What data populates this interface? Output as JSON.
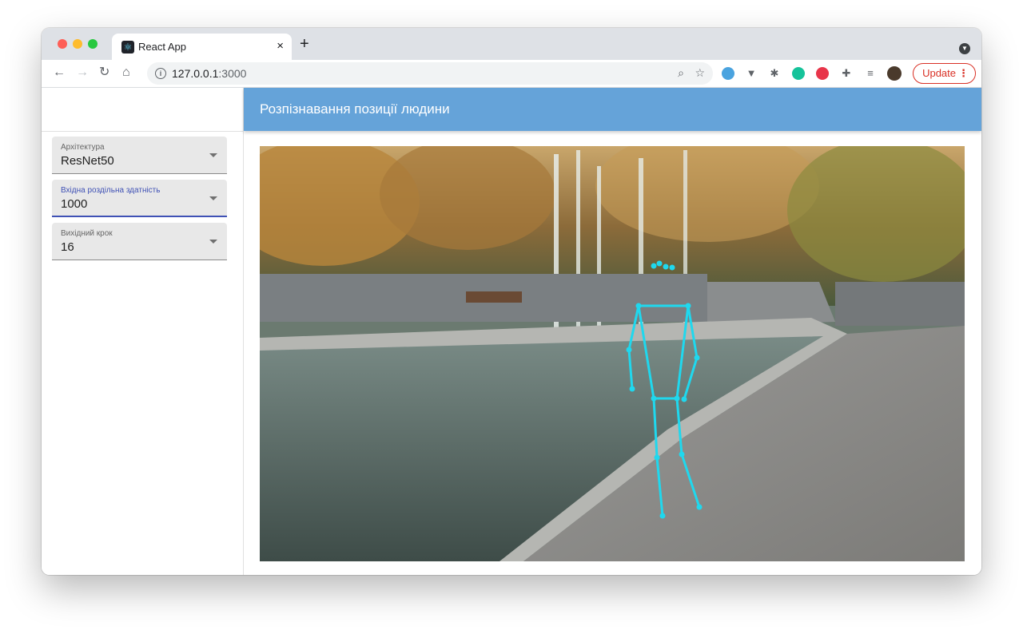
{
  "browser": {
    "tab_title": "React App",
    "tab_close": "×",
    "new_tab": "+",
    "url_host": "127.0.0.1",
    "url_port": ":3000",
    "update_label": "Update",
    "update_menu": "⋮"
  },
  "app": {
    "title": "Розпізнавання позиції людини"
  },
  "controls": [
    {
      "label": "Архітектура",
      "value": "ResNet50"
    },
    {
      "label": "Вхідна роздільна здатність",
      "value": "1000"
    },
    {
      "label": "Вихідний крок",
      "value": "16"
    }
  ],
  "colors": {
    "appbar": "#65a3d9",
    "skeleton": "#1fd8ee",
    "focus": "#3f51b5",
    "update": "#d93025"
  }
}
